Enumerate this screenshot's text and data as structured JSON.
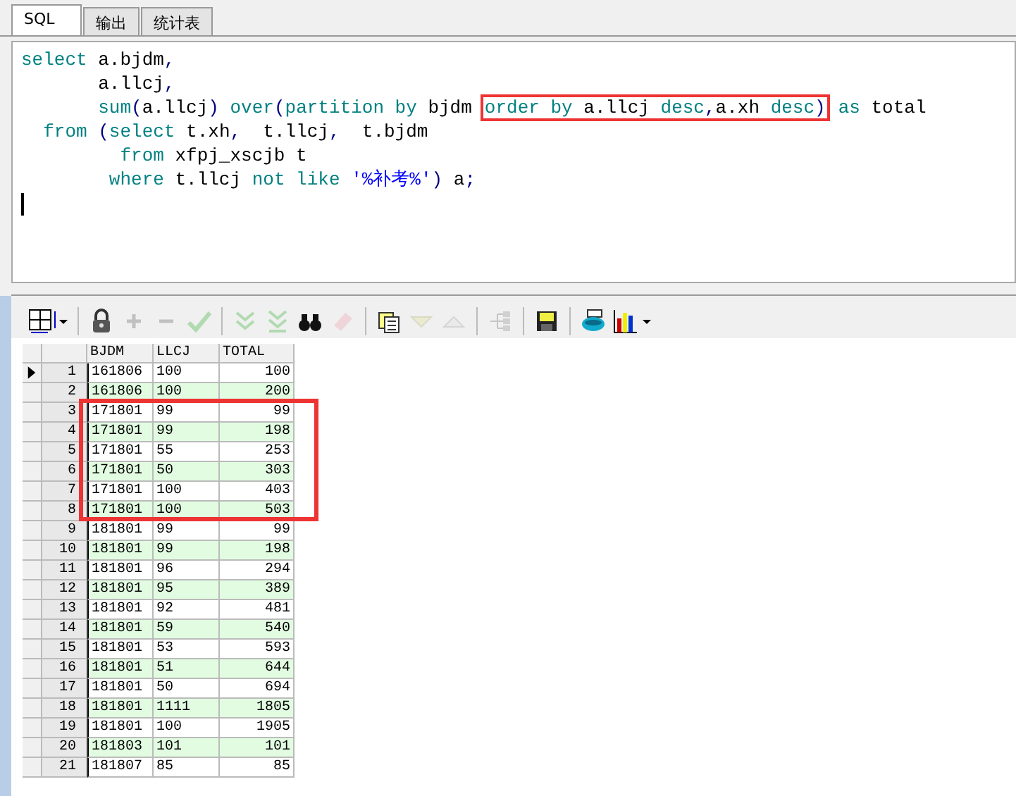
{
  "tabs": [
    {
      "label": "SQL",
      "selected": true
    },
    {
      "label": "输出",
      "selected": false
    },
    {
      "label": "统计表",
      "selected": false
    }
  ],
  "editor": {
    "lines": [
      {
        "parts": [
          {
            "boxed": false,
            "tokens": [
              {
                "text": "select",
                "kind": "kw"
              },
              {
                "text": " a.bjdm",
                "kind": "plain"
              },
              {
                "text": ",",
                "kind": "punct"
              }
            ]
          }
        ]
      },
      {
        "parts": [
          {
            "boxed": false,
            "tokens": [
              {
                "text": "       a.llcj",
                "kind": "plain"
              },
              {
                "text": ",",
                "kind": "punct"
              }
            ]
          }
        ]
      },
      {
        "parts": [
          {
            "boxed": false,
            "tokens": [
              {
                "text": "       sum",
                "kind": "kw"
              },
              {
                "text": "(",
                "kind": "punct"
              },
              {
                "text": "a.llcj",
                "kind": "plain"
              },
              {
                "text": ")",
                "kind": "punct"
              },
              {
                "text": " over",
                "kind": "kw"
              },
              {
                "text": "(",
                "kind": "punct"
              },
              {
                "text": "partition by",
                "kind": "kw"
              },
              {
                "text": " bjdm",
                "kind": "plain"
              }
            ]
          },
          {
            "boxed": true,
            "tokens": [
              {
                "text": "order by",
                "kind": "kw"
              },
              {
                "text": " a.llcj ",
                "kind": "plain"
              },
              {
                "text": "desc",
                "kind": "kw"
              },
              {
                "text": ",",
                "kind": "punct"
              },
              {
                "text": "a.xh ",
                "kind": "plain"
              },
              {
                "text": "desc",
                "kind": "kw"
              },
              {
                "text": ")",
                "kind": "punct"
              }
            ]
          },
          {
            "boxed": false,
            "tokens": [
              {
                "text": "as",
                "kind": "kw"
              },
              {
                "text": " total",
                "kind": "plain"
              }
            ]
          }
        ]
      },
      {
        "parts": [
          {
            "boxed": false,
            "tokens": [
              {
                "text": "  from",
                "kind": "kw"
              },
              {
                "text": " (",
                "kind": "punct"
              },
              {
                "text": "select",
                "kind": "kw"
              },
              {
                "text": " t.xh",
                "kind": "plain"
              },
              {
                "text": ",",
                "kind": "punct"
              },
              {
                "text": "  t.llcj",
                "kind": "plain"
              },
              {
                "text": ",",
                "kind": "punct"
              },
              {
                "text": "  t.bjdm",
                "kind": "plain"
              }
            ]
          }
        ]
      },
      {
        "parts": [
          {
            "boxed": false,
            "tokens": [
              {
                "text": "         from",
                "kind": "kw"
              },
              {
                "text": " xfpj_xscjb t",
                "kind": "plain"
              }
            ]
          }
        ]
      },
      {
        "parts": [
          {
            "boxed": false,
            "tokens": [
              {
                "text": "        where",
                "kind": "kw"
              },
              {
                "text": " t.llcj ",
                "kind": "plain"
              },
              {
                "text": "not like",
                "kind": "kw"
              },
              {
                "text": " '%补考%'",
                "kind": "str"
              },
              {
                "text": ")",
                "kind": "punct"
              },
              {
                "text": " a",
                "kind": "plain"
              },
              {
                "text": ";",
                "kind": "punct"
              }
            ]
          }
        ]
      }
    ]
  },
  "toolbar": [
    {
      "kind": "grid",
      "disabled": false
    },
    {
      "kind": "sep"
    },
    {
      "kind": "lock",
      "disabled": false
    },
    {
      "kind": "plus",
      "disabled": true
    },
    {
      "kind": "minus",
      "disabled": true
    },
    {
      "kind": "check",
      "disabled": true
    },
    {
      "kind": "sep"
    },
    {
      "kind": "next",
      "disabled": true
    },
    {
      "kind": "last",
      "disabled": true
    },
    {
      "kind": "find",
      "disabled": false
    },
    {
      "kind": "eraser",
      "disabled": true
    },
    {
      "kind": "sep"
    },
    {
      "kind": "query",
      "disabled": false
    },
    {
      "kind": "down",
      "disabled": true
    },
    {
      "kind": "up",
      "disabled": true
    },
    {
      "kind": "sep"
    },
    {
      "kind": "tree",
      "disabled": true
    },
    {
      "kind": "sep"
    },
    {
      "kind": "save",
      "disabled": false
    },
    {
      "kind": "sep"
    },
    {
      "kind": "export",
      "disabled": false
    },
    {
      "kind": "chart",
      "disabled": false
    }
  ],
  "table": {
    "columns": [
      "BJDM",
      "LLCJ",
      "TOTAL"
    ],
    "rows": [
      {
        "number": "1",
        "cells": [
          "161806",
          "100",
          "100"
        ],
        "current": true,
        "highlighted": false
      },
      {
        "number": "2",
        "cells": [
          "161806",
          "100",
          "200"
        ],
        "current": false,
        "highlighted": false
      },
      {
        "number": "3",
        "cells": [
          "171801",
          "99",
          "99"
        ],
        "current": false,
        "highlighted": true
      },
      {
        "number": "4",
        "cells": [
          "171801",
          "99",
          "198"
        ],
        "current": false,
        "highlighted": true
      },
      {
        "number": "5",
        "cells": [
          "171801",
          "55",
          "253"
        ],
        "current": false,
        "highlighted": true
      },
      {
        "number": "6",
        "cells": [
          "171801",
          "50",
          "303"
        ],
        "current": false,
        "highlighted": true
      },
      {
        "number": "7",
        "cells": [
          "171801",
          "100",
          "403"
        ],
        "current": false,
        "highlighted": true
      },
      {
        "number": "8",
        "cells": [
          "171801",
          "100",
          "503"
        ],
        "current": false,
        "highlighted": true
      },
      {
        "number": "9",
        "cells": [
          "181801",
          "99",
          "99"
        ],
        "current": false,
        "highlighted": false
      },
      {
        "number": "10",
        "cells": [
          "181801",
          "99",
          "198"
        ],
        "current": false,
        "highlighted": false
      },
      {
        "number": "11",
        "cells": [
          "181801",
          "96",
          "294"
        ],
        "current": false,
        "highlighted": false
      },
      {
        "number": "12",
        "cells": [
          "181801",
          "95",
          "389"
        ],
        "current": false,
        "highlighted": false
      },
      {
        "number": "13",
        "cells": [
          "181801",
          "92",
          "481"
        ],
        "current": false,
        "highlighted": false
      },
      {
        "number": "14",
        "cells": [
          "181801",
          "59",
          "540"
        ],
        "current": false,
        "highlighted": false
      },
      {
        "number": "15",
        "cells": [
          "181801",
          "53",
          "593"
        ],
        "current": false,
        "highlighted": false
      },
      {
        "number": "16",
        "cells": [
          "181801",
          "51",
          "644"
        ],
        "current": false,
        "highlighted": false
      },
      {
        "number": "17",
        "cells": [
          "181801",
          "50",
          "694"
        ],
        "current": false,
        "highlighted": false
      },
      {
        "number": "18",
        "cells": [
          "181801",
          "1111",
          "1805"
        ],
        "current": false,
        "highlighted": false
      },
      {
        "number": "19",
        "cells": [
          "181801",
          "100",
          "1905"
        ],
        "current": false,
        "highlighted": false
      },
      {
        "number": "20",
        "cells": [
          "181803",
          "101",
          "101"
        ],
        "current": false,
        "highlighted": false
      },
      {
        "number": "21",
        "cells": [
          "181807",
          "85",
          "85"
        ],
        "current": false,
        "highlighted": false
      }
    ]
  }
}
